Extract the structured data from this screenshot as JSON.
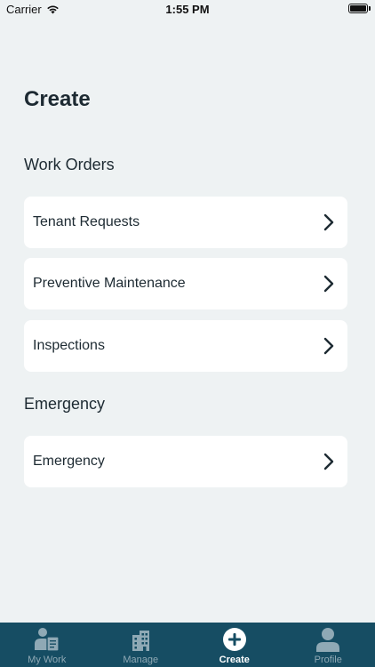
{
  "status_bar": {
    "carrier": "Carrier",
    "time": "1:55 PM"
  },
  "page": {
    "title": "Create"
  },
  "sections": [
    {
      "title": "Work Orders",
      "items": [
        {
          "label": "Tenant Requests"
        },
        {
          "label": "Preventive Maintenance"
        },
        {
          "label": "Inspections"
        }
      ]
    },
    {
      "title": "Emergency",
      "items": [
        {
          "label": "Emergency"
        }
      ]
    }
  ],
  "tab_bar": {
    "tabs": [
      {
        "label": "My Work",
        "icon": "worker-clipboard-icon",
        "active": false
      },
      {
        "label": "Manage",
        "icon": "building-icon",
        "active": false
      },
      {
        "label": "Create",
        "icon": "plus-circle-icon",
        "active": true
      },
      {
        "label": "Profile",
        "icon": "person-icon",
        "active": false
      }
    ]
  },
  "colors": {
    "background": "#eef2f3",
    "tab_bar": "#164d63",
    "tab_inactive": "#8fa9b5",
    "tab_active": "#ffffff",
    "text": "#1d2a32"
  }
}
